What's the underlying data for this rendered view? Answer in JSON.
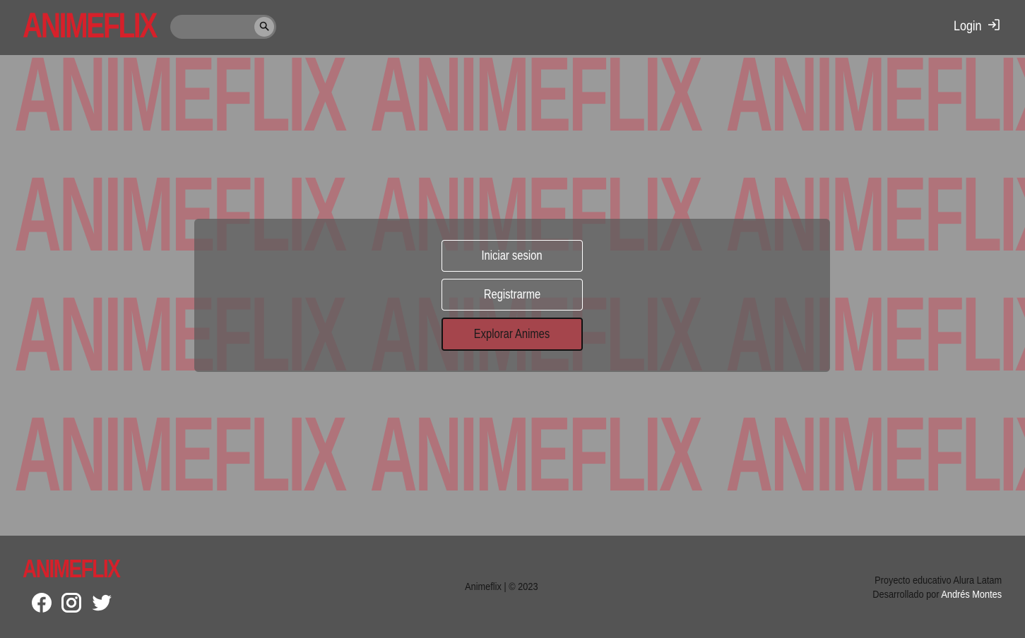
{
  "brand": {
    "logo_text": "ANIMEFLIX",
    "color": "#d6202a"
  },
  "header": {
    "search": {
      "placeholder": "",
      "value": "",
      "icon": "search-icon"
    },
    "login": {
      "label": "Login",
      "icon": "login-icon"
    }
  },
  "hero": {
    "watermark_text": "ANIMEFLIX",
    "buttons": {
      "login": "Iniciar sesion",
      "register": "Registrarme",
      "explore": "Explorar Animes"
    },
    "accent_color": "#a5454c"
  },
  "footer": {
    "logo_text": "ANIMEFLIX",
    "social": [
      "facebook-icon",
      "instagram-icon",
      "twitter-icon"
    ],
    "copyright": "Animeflix | © 2023",
    "project_line": "Proyecto educativo Alura Latam",
    "developer_prefix": "Desarrollado por",
    "developer_name": "Andrés Montes"
  }
}
